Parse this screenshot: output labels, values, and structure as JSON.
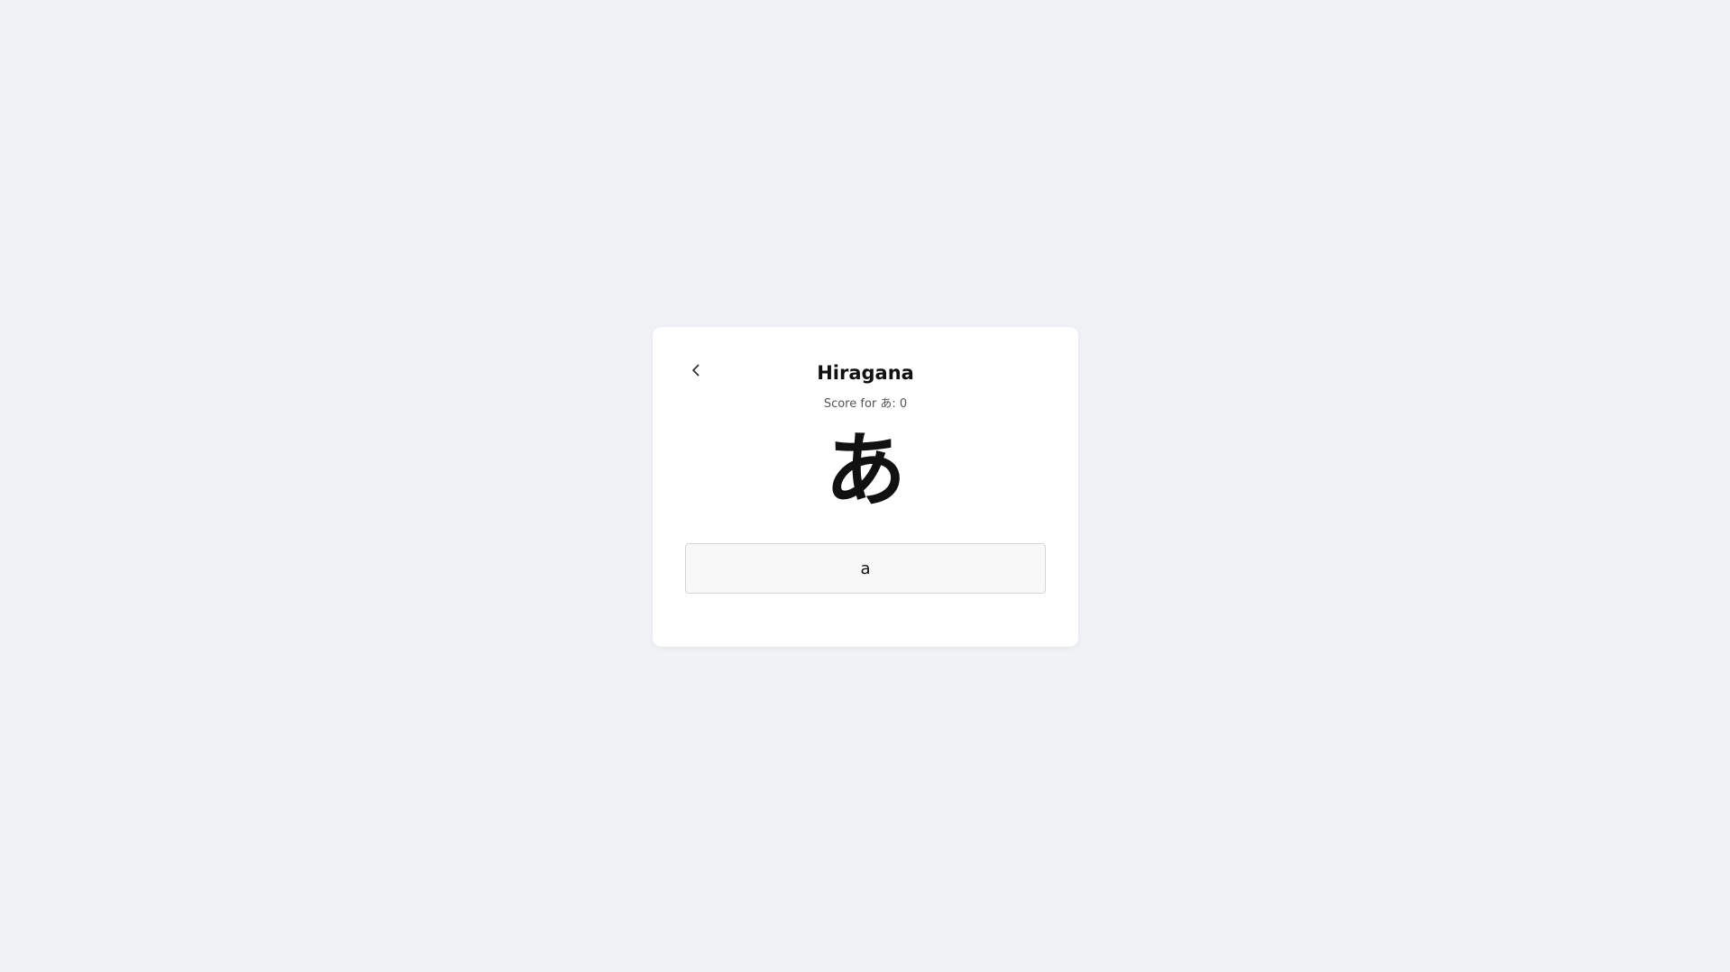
{
  "card": {
    "title": "Hiragana",
    "score_text": "Score for あ: 0",
    "character": "あ",
    "answer": {
      "value": "a",
      "placeholder": ""
    },
    "back_icon": "chevron-left-icon"
  },
  "colors": {
    "background": "#f0f2f5",
    "card": "#ffffff",
    "text": "#111111",
    "muted_text": "#555555",
    "input_background": "#f8f8f8",
    "input_border": "#d4d4d4"
  }
}
